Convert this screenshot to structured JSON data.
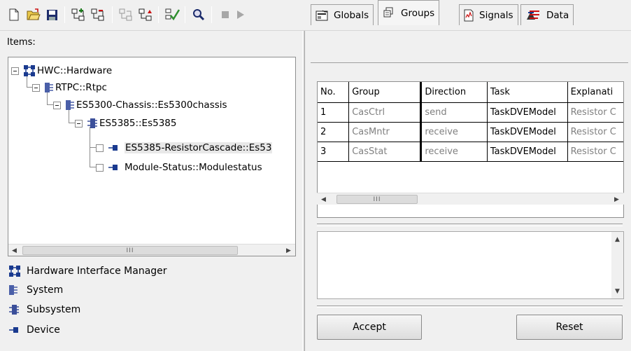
{
  "toolbar": {
    "buttons": [
      "new-icon",
      "open-icon",
      "save-icon",
      "add-group-icon",
      "remove-group-icon",
      "import-icon",
      "export-icon",
      "check-icon",
      "search-icon",
      "stop-icon",
      "play-icon"
    ]
  },
  "items_label": "Items:",
  "tree": {
    "nodes": [
      {
        "label": "HWC::Hardware",
        "icon": "hardware-interface-manager-icon"
      },
      {
        "label": "RTPC::Rtpc",
        "icon": "system-icon"
      },
      {
        "label": "ES5300-Chassis::Es5300chassis",
        "icon": "system-icon"
      },
      {
        "label": "ES5385::Es5385",
        "icon": "subsystem-icon"
      },
      {
        "label": "ES5385-ResistorCascade::Es53",
        "icon": "device-icon"
      },
      {
        "label": "Module-Status::Modulestatus",
        "icon": "device-icon"
      }
    ]
  },
  "legend": [
    {
      "label": "Hardware Interface Manager",
      "icon": "hardware-interface-manager-icon"
    },
    {
      "label": "System",
      "icon": "system-icon"
    },
    {
      "label": "Subsystem",
      "icon": "subsystem-icon"
    },
    {
      "label": "Device",
      "icon": "device-icon"
    }
  ],
  "tabs": [
    {
      "label": "Globals",
      "icon": "globals-icon",
      "active": false
    },
    {
      "label": "Groups",
      "icon": "groups-icon",
      "active": true
    },
    {
      "label": "Signals",
      "icon": "signals-icon",
      "active": false
    },
    {
      "label": "Data",
      "icon": "data-icon",
      "active": false
    }
  ],
  "grid": {
    "columns": [
      "No.",
      "Group",
      "Direction",
      "Task",
      "Explanati"
    ],
    "rows": [
      [
        "1",
        "CasCtrl",
        "send",
        "TaskDVEModel",
        "Resistor C"
      ],
      [
        "2",
        "CasMntr",
        "receive",
        "TaskDVEModel",
        "Resistor C"
      ],
      [
        "3",
        "CasStat",
        "receive",
        "TaskDVEModel",
        "Resistor C"
      ]
    ]
  },
  "scroll_thumb_label": "III",
  "buttons": {
    "accept": "Accept",
    "reset": "Reset"
  },
  "colors": {
    "device_blue": "#1a3a8f",
    "system_blue": "#4a5fa8",
    "check_green": "#2f8f2f",
    "grid_dim_text": "#808080"
  }
}
